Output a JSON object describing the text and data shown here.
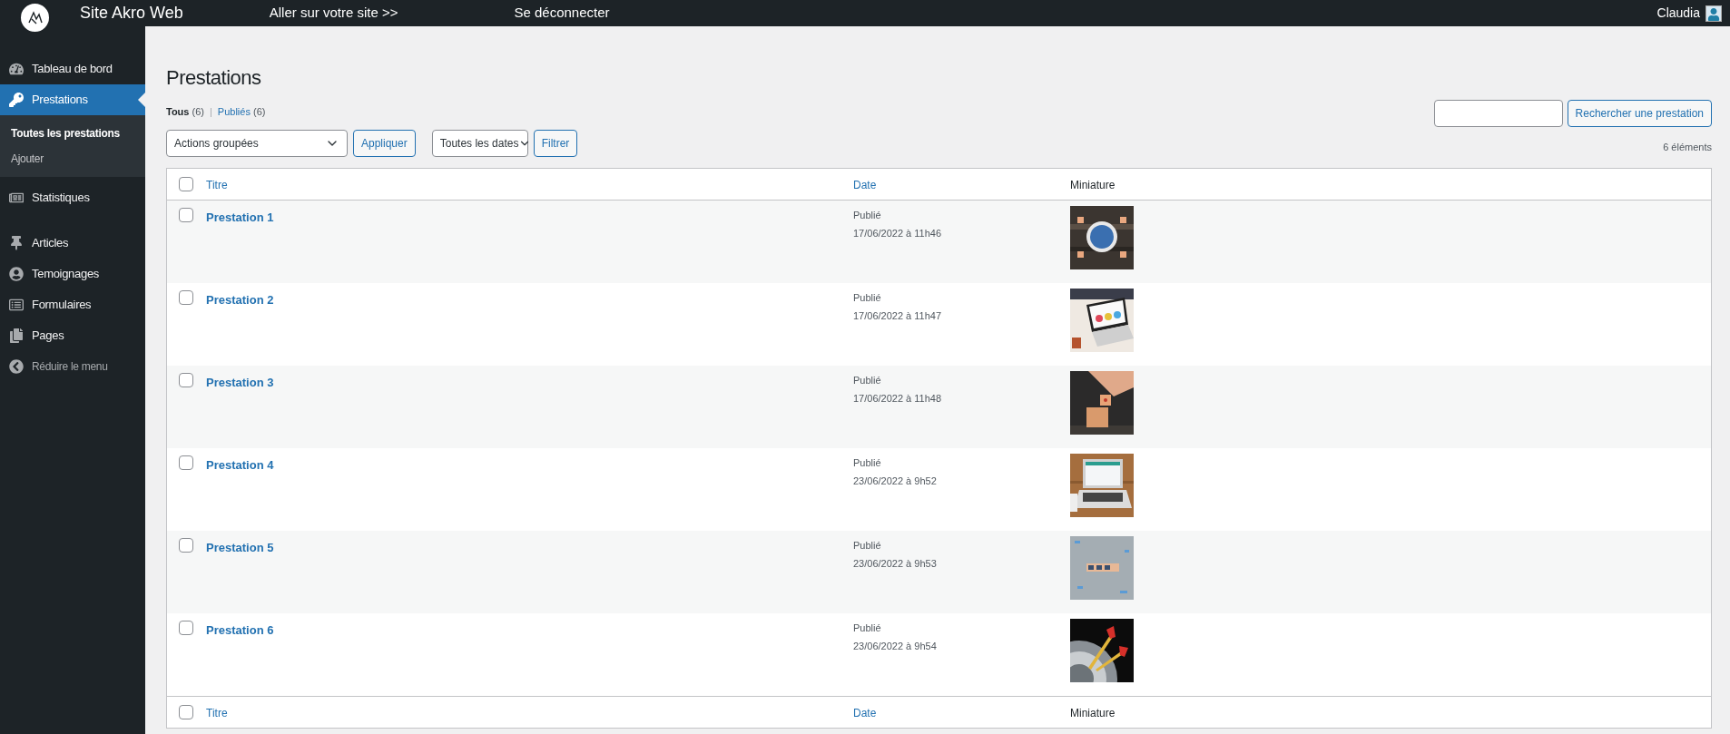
{
  "topbar": {
    "site_name": "Site Akro Web",
    "visit_link": "Aller sur votre site >>",
    "logout_link": "Se déconnecter",
    "user": "Claudia"
  },
  "sidebar": {
    "items": [
      {
        "label": "Tableau de bord",
        "selected": false
      },
      {
        "label": "Prestations",
        "selected": true,
        "children": [
          {
            "label": "Toutes les prestations",
            "selected": true
          },
          {
            "label": "Ajouter",
            "selected": false
          }
        ]
      },
      {
        "label": "Statistiques",
        "selected": false
      },
      {
        "label": "Articles",
        "selected": false
      },
      {
        "label": "Temoignages",
        "selected": false
      },
      {
        "label": "Formulaires",
        "selected": false
      },
      {
        "label": "Pages",
        "selected": false
      }
    ],
    "collapse": "Réduire le menu"
  },
  "page_title": "Prestations",
  "filter_separator": "|",
  "filters": [
    {
      "label": "Tous",
      "count": "(6)",
      "selected": true
    },
    {
      "label": "Publiés",
      "count": "(6)",
      "selected": false
    }
  ],
  "bulk_actions": {
    "value": "Actions groupées",
    "apply": "Appliquer"
  },
  "date_filter": {
    "value": "Toutes les dates",
    "apply": "Filtrer"
  },
  "search": {
    "button": "Rechercher une prestation"
  },
  "item_count": "6 éléments",
  "table": {
    "select_all_checked": false,
    "columns": [
      {
        "label": "Titre",
        "kind": "sortable"
      },
      {
        "label": "Date",
        "kind": "sortable"
      },
      {
        "label": "Miniature",
        "kind": "plain"
      }
    ],
    "rows": [
      {
        "title": "Prestation 1",
        "status": "Publié",
        "date": "17/06/2022 à 11h46",
        "checked": false
      },
      {
        "title": "Prestation 2",
        "status": "Publié",
        "date": "17/06/2022 à 11h47",
        "checked": false
      },
      {
        "title": "Prestation 3",
        "status": "Publié",
        "date": "17/06/2022 à 11h48",
        "checked": false
      },
      {
        "title": "Prestation 4",
        "status": "Publié",
        "date": "23/06/2022 à 9h52",
        "checked": false
      },
      {
        "title": "Prestation 5",
        "status": "Publié",
        "date": "23/06/2022 à 9h53",
        "checked": false
      },
      {
        "title": "Prestation 6",
        "status": "Publié",
        "date": "23/06/2022 à 9h54",
        "checked": false
      }
    ],
    "footer_select_all_checked": false,
    "footer_columns": [
      {
        "label": "Titre",
        "kind": "sortable"
      },
      {
        "label": "Date",
        "kind": "sortable"
      },
      {
        "label": "Miniature",
        "kind": "plain"
      }
    ]
  }
}
